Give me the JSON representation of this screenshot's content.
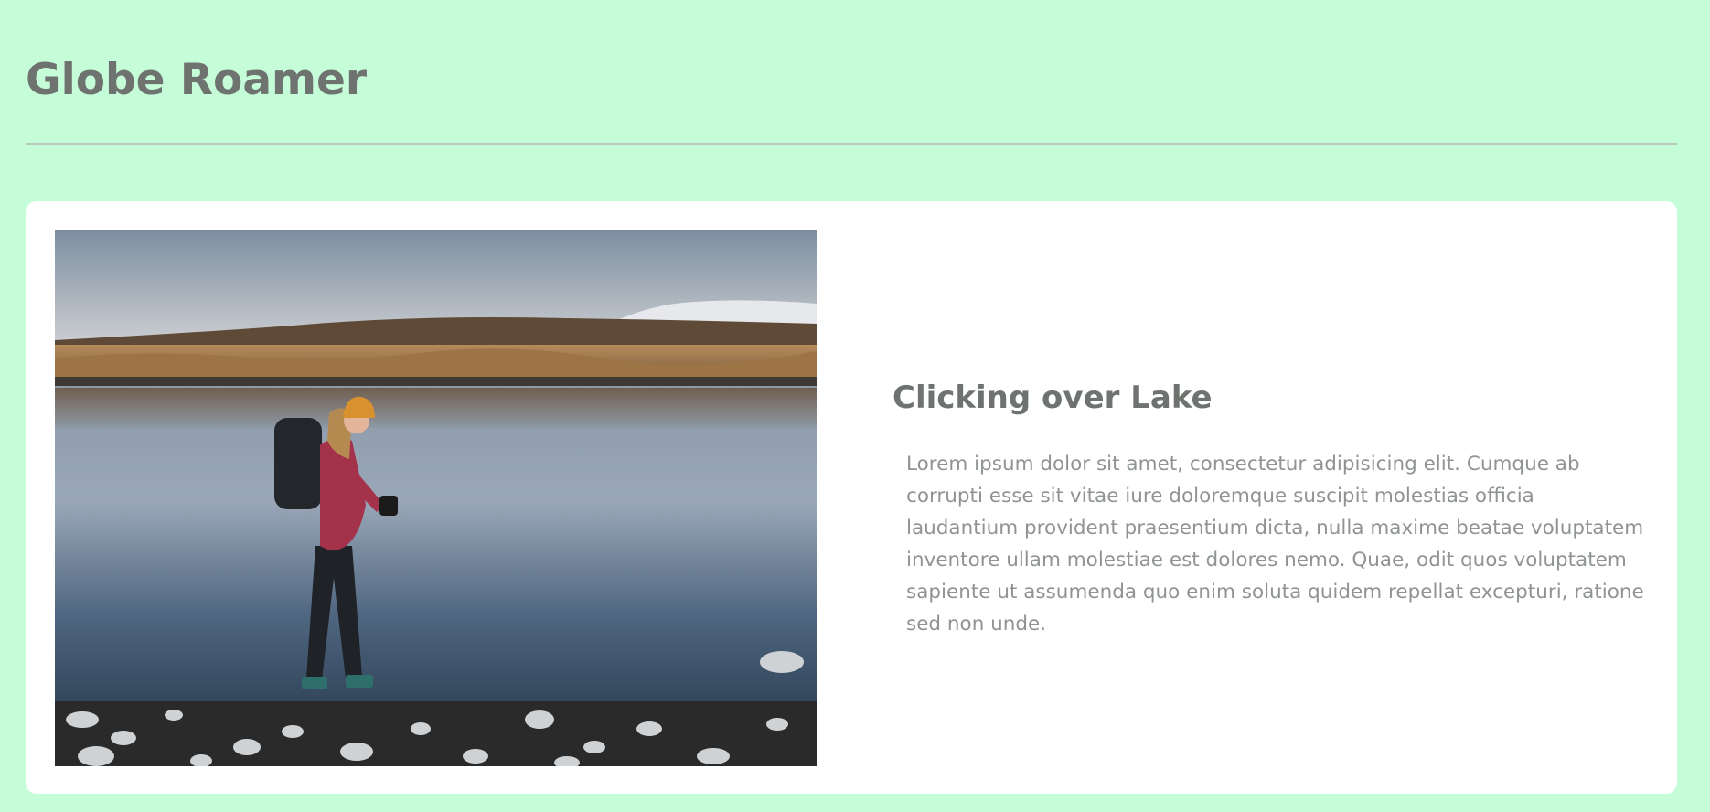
{
  "header": {
    "title": "Globe Roamer"
  },
  "card": {
    "title": "Clicking over Lake",
    "body": "Lorem ipsum dolor sit amet, consectetur adipisicing elit. Cumque ab corrupti esse sit vitae iure doloremque suscipit molestias officia laudantium provident praesentium dicta, nulla maxime beatae voluptatem inventore ullam molestiae est dolores nemo. Quae, odit quos voluptatem sapiente ut assumenda quo enim soluta quidem repellat excepturi, ratione sed non unde.",
    "image_subject": "hiker-with-camera-at-lake"
  },
  "colors": {
    "background": "#c6fdd9",
    "card": "#ffffff",
    "heading": "#6e736f",
    "body_text": "#8f9491",
    "divider": "#b9c9bf"
  }
}
